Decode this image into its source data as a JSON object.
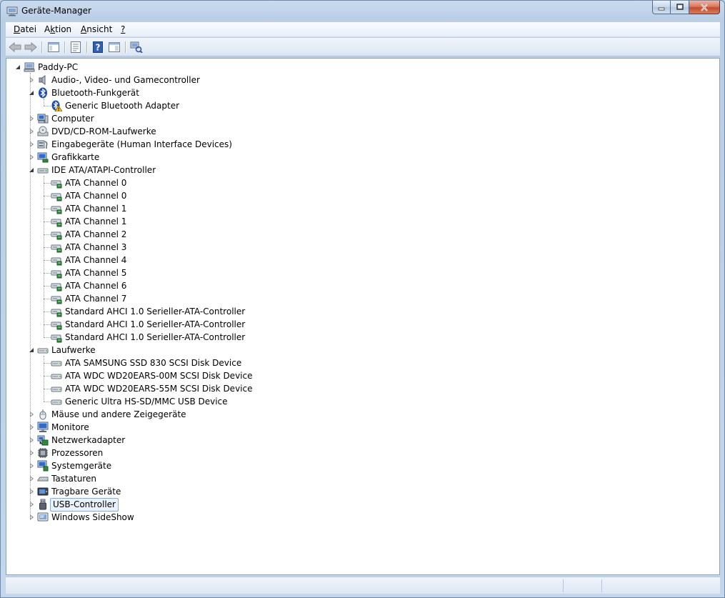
{
  "window": {
    "title": "Geräte-Manager",
    "icon": "device-manager-icon"
  },
  "menu": {
    "items": [
      {
        "id": "datei",
        "pre": "",
        "u": "D",
        "post": "atei"
      },
      {
        "id": "aktion",
        "pre": "A",
        "u": "k",
        "post": "tion"
      },
      {
        "id": "ansicht",
        "pre": "",
        "u": "A",
        "post": "nsicht"
      },
      {
        "id": "help",
        "pre": "",
        "u": "?",
        "post": ""
      }
    ]
  },
  "toolbar": {
    "buttons": [
      "back-arrow-icon",
      "forward-arrow-icon",
      "show-hide-console-tree-icon",
      "properties-icon",
      "help-icon",
      "action-pane-icon",
      "scan-hardware-icon"
    ]
  },
  "tree": {
    "root": "Paddy-PC",
    "categories": [
      {
        "label": "Audio-, Video- und Gamecontroller",
        "icon": "speaker-icon",
        "expanded": false,
        "children": []
      },
      {
        "label": "Bluetooth-Funkgerät",
        "icon": "bluetooth-icon",
        "expanded": true,
        "children": [
          {
            "label": "Generic Bluetooth Adapter",
            "icon": "bluetooth-warning-icon"
          }
        ]
      },
      {
        "label": "Computer",
        "icon": "computer-icon",
        "expanded": false,
        "children": []
      },
      {
        "label": "DVD/CD-ROM-Laufwerke",
        "icon": "optical-drive-icon",
        "expanded": false,
        "children": []
      },
      {
        "label": "Eingabegeräte (Human Interface Devices)",
        "icon": "hid-icon",
        "expanded": false,
        "children": []
      },
      {
        "label": "Grafikkarte",
        "icon": "display-adapter-icon",
        "expanded": false,
        "children": []
      },
      {
        "label": "IDE ATA/ATAPI-Controller",
        "icon": "ide-controller-icon",
        "expanded": true,
        "children": [
          {
            "label": "ATA Channel 0",
            "icon": "ide-channel-icon"
          },
          {
            "label": "ATA Channel 0",
            "icon": "ide-channel-icon"
          },
          {
            "label": "ATA Channel 1",
            "icon": "ide-channel-icon"
          },
          {
            "label": "ATA Channel 1",
            "icon": "ide-channel-icon"
          },
          {
            "label": "ATA Channel 2",
            "icon": "ide-channel-icon"
          },
          {
            "label": "ATA Channel 3",
            "icon": "ide-channel-icon"
          },
          {
            "label": "ATA Channel 4",
            "icon": "ide-channel-icon"
          },
          {
            "label": "ATA Channel 5",
            "icon": "ide-channel-icon"
          },
          {
            "label": "ATA Channel 6",
            "icon": "ide-channel-icon"
          },
          {
            "label": "ATA Channel 7",
            "icon": "ide-channel-icon"
          },
          {
            "label": "Standard AHCI 1.0 Serieller-ATA-Controller",
            "icon": "ide-channel-icon"
          },
          {
            "label": "Standard AHCI 1.0 Serieller-ATA-Controller",
            "icon": "ide-channel-icon"
          },
          {
            "label": "Standard AHCI 1.0 Serieller-ATA-Controller",
            "icon": "ide-channel-icon"
          }
        ]
      },
      {
        "label": "Laufwerke",
        "icon": "disk-drive-icon",
        "expanded": true,
        "children": [
          {
            "label": "ATA SAMSUNG SSD 830 SCSI Disk Device",
            "icon": "disk-drive-icon"
          },
          {
            "label": "ATA WDC WD20EARS-00M SCSI Disk Device",
            "icon": "disk-drive-icon"
          },
          {
            "label": "ATA WDC WD20EARS-55M SCSI Disk Device",
            "icon": "disk-drive-icon"
          },
          {
            "label": "Generic Ultra HS-SD/MMC USB Device",
            "icon": "disk-drive-icon"
          }
        ]
      },
      {
        "label": "Mäuse und andere Zeigegeräte",
        "icon": "mouse-icon",
        "expanded": false,
        "children": []
      },
      {
        "label": "Monitore",
        "icon": "monitor-icon",
        "expanded": false,
        "children": []
      },
      {
        "label": "Netzwerkadapter",
        "icon": "network-adapter-icon",
        "expanded": false,
        "children": []
      },
      {
        "label": "Prozessoren",
        "icon": "processor-icon",
        "expanded": false,
        "children": []
      },
      {
        "label": "Systemgeräte",
        "icon": "system-devices-icon",
        "expanded": false,
        "children": []
      },
      {
        "label": "Tastaturen",
        "icon": "keyboard-icon",
        "expanded": false,
        "children": []
      },
      {
        "label": "Tragbare Geräte",
        "icon": "portable-device-icon",
        "expanded": false,
        "children": []
      },
      {
        "label": "USB-Controller",
        "icon": "usb-icon",
        "expanded": false,
        "selected": true,
        "children": []
      },
      {
        "label": "Windows SideShow",
        "icon": "sideshow-icon",
        "expanded": false,
        "children": []
      }
    ]
  },
  "colors": {
    "selection_bg": "#eaf3fd",
    "selection_border": "#84acdd",
    "chrome": "#c4d6ea"
  }
}
